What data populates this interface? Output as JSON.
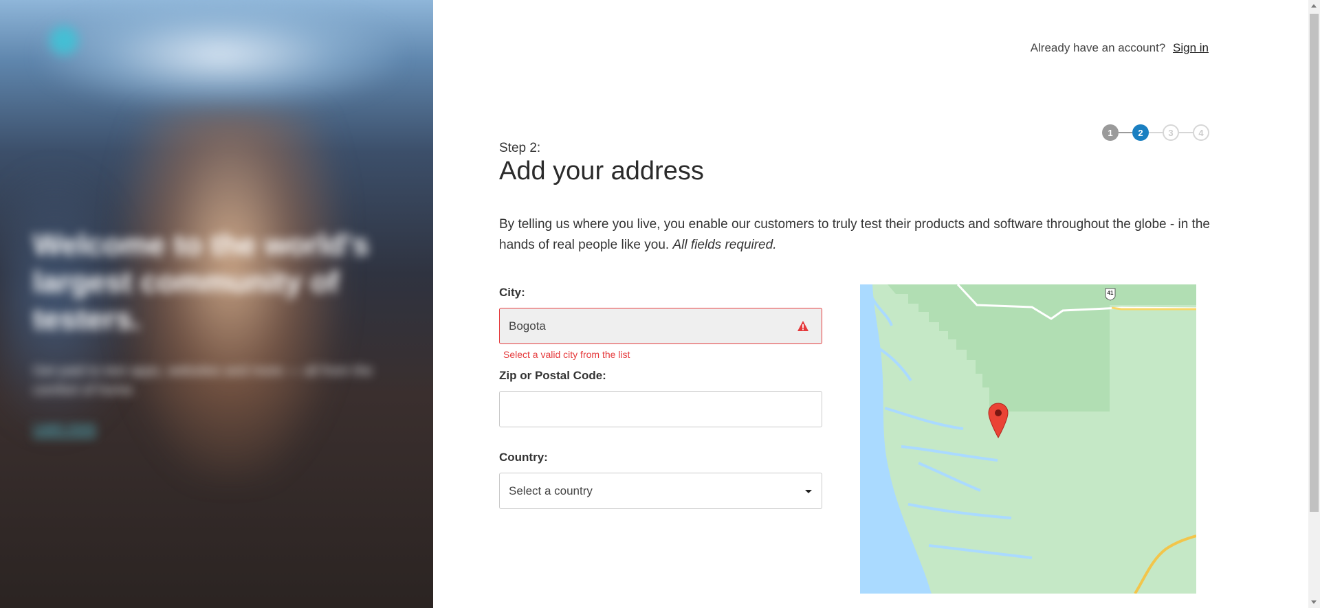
{
  "hero": {
    "title": "Welcome to the world's largest community of testers.",
    "subtitle": "Get paid to test apps, websites and more — all from the comfort of home.",
    "link": "Learn more"
  },
  "header": {
    "account_prompt": "Already have an account?",
    "signin_label": "Sign in"
  },
  "stepper": {
    "steps": [
      "1",
      "2",
      "3",
      "4"
    ],
    "current": 2
  },
  "page": {
    "step_label": "Step 2:",
    "title": "Add your address",
    "intro": "By telling us where you live, you enable our customers to truly test their products and software throughout the globe - in the hands of real people like you.",
    "intro_emphasis": "All fields required."
  },
  "form": {
    "city": {
      "label": "City:",
      "value": "Bogota",
      "error": "Select a valid city from the list"
    },
    "zip": {
      "label": "Zip or Postal Code:",
      "value": ""
    },
    "country": {
      "label": "Country:",
      "selected": "Select a country"
    }
  },
  "map": {
    "highway_label": "41"
  },
  "colors": {
    "accent": "#1a7fc1",
    "error": "#e5393b",
    "step_done": "#9a9a9a",
    "map_land": "#c5e8c6",
    "map_water": "#aadaff"
  }
}
